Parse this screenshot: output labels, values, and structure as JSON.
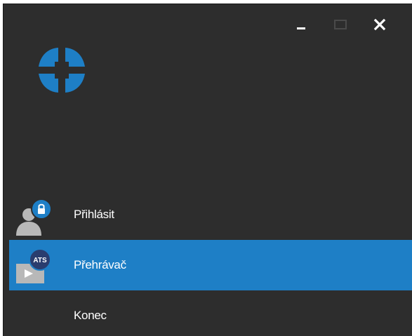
{
  "window": {
    "controls": {
      "minimize_icon": "minimize-icon",
      "maximize_icon": "maximize-icon",
      "close_icon": "close-icon"
    }
  },
  "logo": {
    "icon": "crosshair-logo-icon",
    "color": "#1e7fc6"
  },
  "menu": {
    "items": [
      {
        "label": "Přihlásit",
        "icon": "user-lock-icon",
        "selected": false
      },
      {
        "label": "Přehrávač",
        "icon": "ats-player-icon",
        "badge": "ATS",
        "selected": true
      },
      {
        "label": "Konec",
        "selected": false
      }
    ]
  },
  "colors": {
    "background": "#2d2d2d",
    "accent": "#1e7fc6",
    "text": "#ffffff"
  }
}
